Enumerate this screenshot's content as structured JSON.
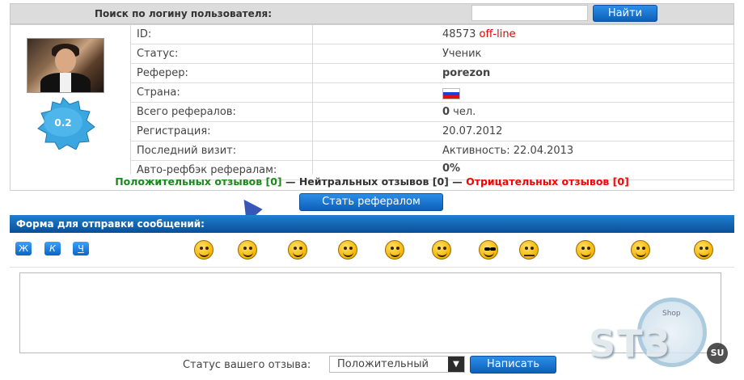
{
  "search": {
    "title": "Поиск по логину пользователя:",
    "placeholder": "",
    "button_label": "Найти"
  },
  "profile": {
    "rating": "0.2",
    "rows": [
      {
        "label": "ID:",
        "value": "48573",
        "extra": "off-line"
      },
      {
        "label": "Статус:",
        "value": "Ученик"
      },
      {
        "label": "Реферер:",
        "value": "porezon"
      },
      {
        "label": "Страна:",
        "value": "flag-icon-ru"
      },
      {
        "label": "Всего рефералов:",
        "value_bold": "0",
        "value": " чел."
      },
      {
        "label": "Регистрация:",
        "value": "20.07.2012"
      },
      {
        "label": "Последний визит:",
        "value": "Активность: 22.04.2013"
      },
      {
        "label": "Авто-рефбэк рефералам:",
        "value": "0%"
      }
    ]
  },
  "reviews": {
    "positive": "Положительных отзывов [0]",
    "sep1": " — ",
    "neutral": "Нейтральных отзывов [0]",
    "sep2": " — ",
    "negative": "Отрицательных отзывов [0]"
  },
  "become_referral_label": "Стать рефералом",
  "message_form": {
    "title": "Форма для отправки сообщений:",
    "format_buttons": [
      "Ж",
      "К",
      "Ч"
    ],
    "smileys": [
      "laugh-smiley-icon",
      "smile-smiley-icon",
      "cool-smiley-icon",
      "wink-smiley-icon",
      "grin-smiley-icon",
      "crazy-smiley-icon",
      "sunglasses-smiley-icon",
      "neutral-smiley-icon",
      "reading-smiley-icon",
      "group-smiley-icon",
      "tired-smiley-icon"
    ],
    "textarea_value": "",
    "status_label": "Статус вашего отзыва:",
    "status_value": "Положительный",
    "send_label": "Написать"
  },
  "watermark": {
    "text": "ST3",
    "suffix": "SU",
    "badge": "Shop"
  },
  "colors": {
    "accent_blue": "#0e5fb8",
    "offline_red": "#e00000",
    "referer_orange": "#e07000",
    "activity_green": "#1a8a1a",
    "header_gray": "#dcdcdc"
  }
}
